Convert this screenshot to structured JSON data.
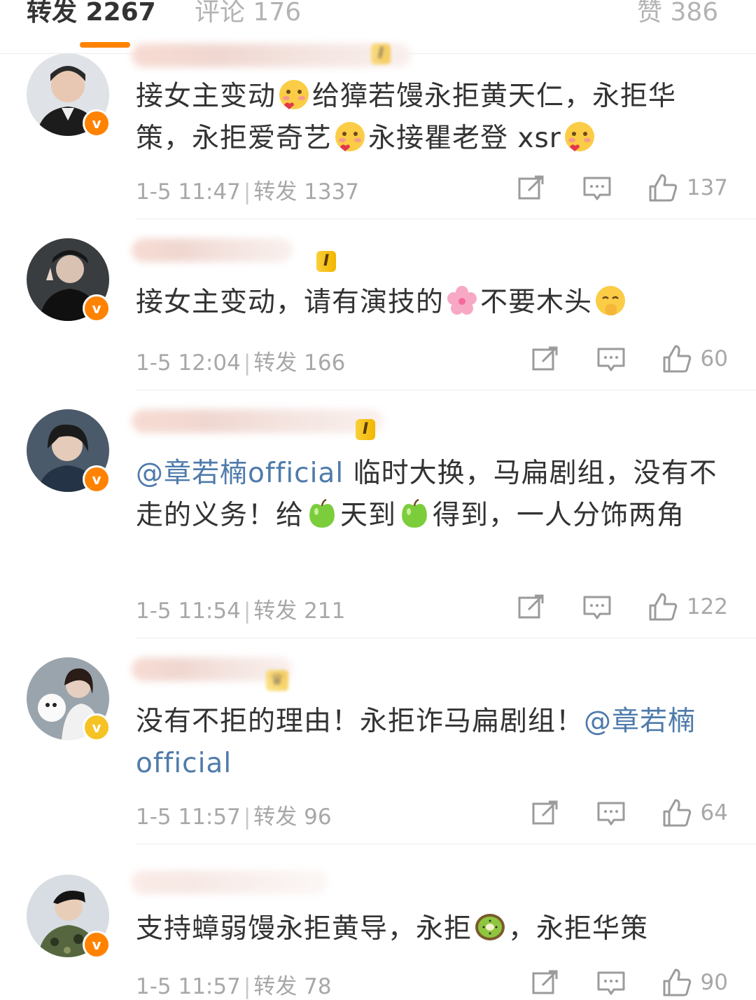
{
  "tabs": [
    {
      "label": "转发 2267",
      "active": true
    },
    {
      "label": "评论 176",
      "active": false
    },
    {
      "label": "赞 386",
      "active": false
    }
  ],
  "colors": {
    "accent": "#ff8200",
    "mention": "#4f7bab",
    "meta": "#a8a8a8"
  },
  "comments": [
    {
      "avatar_icon": "user-avatar-icon",
      "level_badge": "I",
      "segments": [
        "接女主变动",
        "给獐若馒永拒黄天仁，永拒华策，永拒爱奇艺",
        "永接瞿老登 xsr"
      ],
      "emojis": [
        "smiling-blushing-emoji",
        "smiling-blushing-emoji",
        "smiling-blushing-emoji"
      ],
      "time": "1-5 11:47",
      "repost_label": "转发 1337",
      "likes": "137"
    },
    {
      "avatar_icon": "user-avatar-icon",
      "level_badge": "I",
      "segments": [
        "接女主变动，请有演技的",
        "不要木头"
      ],
      "emojis": [
        "cherry-blossom-emoji",
        "face-peeking-emoji"
      ],
      "time": "1-5 12:04",
      "repost_label": "转发 166",
      "likes": "60"
    },
    {
      "avatar_icon": "user-avatar-icon",
      "level_badge": "I",
      "mention": "@章若楠official",
      "segments": [
        " 临时大换，马扁剧组，没有不走的义务！给",
        "天到",
        "得到，一人分饰两角"
      ],
      "emojis": [
        "green-apple-emoji",
        "green-apple-emoji"
      ],
      "time": "1-5 11:54",
      "repost_label": "转发 211",
      "likes": "122"
    },
    {
      "avatar_icon": "user-avatar-icon",
      "segments": [
        "没有不拒的理由！永拒诈马扁剧组！"
      ],
      "mention_end": "@章若楠official",
      "time": "1-5 11:57",
      "repost_label": "转发 96",
      "likes": "64"
    },
    {
      "avatar_icon": "user-avatar-icon",
      "segments": [
        "支持蟑弱馒永拒黄导，永拒",
        "，永拒华策"
      ],
      "emojis": [
        "kiwi-fruit-emoji"
      ],
      "time": "1-5 11:57",
      "repost_label": "转发 78",
      "likes": "90"
    }
  ]
}
